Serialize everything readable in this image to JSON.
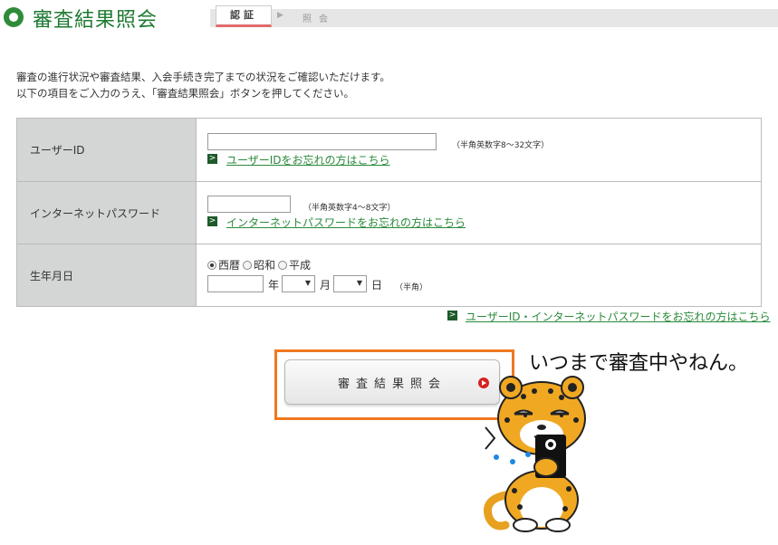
{
  "header": {
    "title": "審査結果照会",
    "step_current": "認証",
    "step_next": "照会"
  },
  "intro": {
    "line1": "審査の進行状況や審査結果、入会手続き完了までの状況をご確認いただけます。",
    "line2": "以下の項目をご入力のうえ、「審査結果照会」ボタンを押してください。"
  },
  "form": {
    "user_id": {
      "label": "ユーザーID",
      "value": "",
      "hint": "（半角英数字8～32文字）",
      "link": "ユーザーIDをお忘れの方はこちら"
    },
    "password": {
      "label": "インターネットパスワード",
      "value": "",
      "hint": "（半角英数字4～8文字）",
      "link": "インターネットパスワードをお忘れの方はこちら"
    },
    "birthdate": {
      "label": "生年月日",
      "eras": [
        {
          "label": "西暦",
          "selected": true
        },
        {
          "label": "昭和",
          "selected": false
        },
        {
          "label": "平成",
          "selected": false
        }
      ],
      "year_unit": "年",
      "month_unit": "月",
      "day_unit": "日",
      "hint": "（半角）"
    }
  },
  "forgot_both_link": "ユーザーID・インターネットパスワードをお忘れの方はこちら",
  "submit_label": "審査結果照会",
  "mascot": {
    "speech": "いつまで審査中やねん。"
  },
  "colors": {
    "brand_green": "#1e7a32",
    "link_green": "#2a8a3a",
    "highlight_orange": "#f07820",
    "label_bg": "#d3d6d5"
  }
}
